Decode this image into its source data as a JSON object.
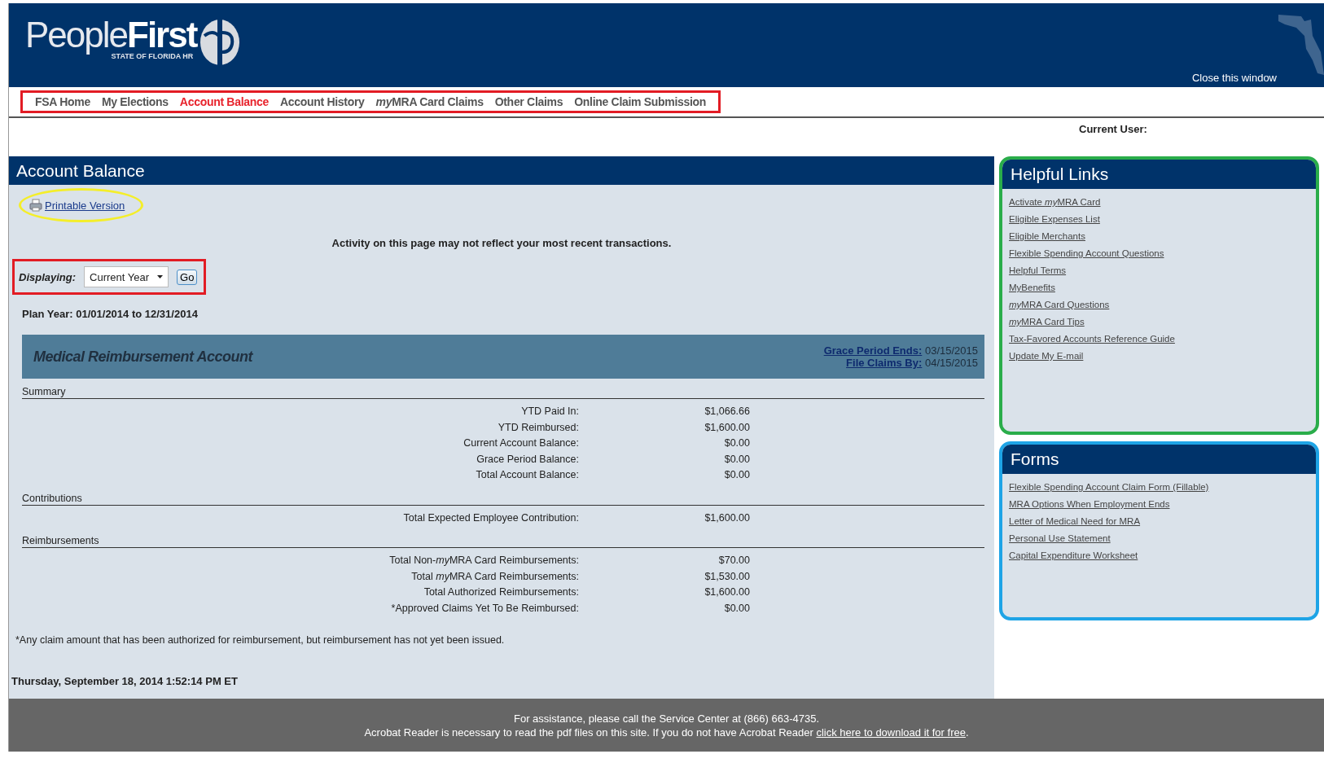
{
  "header": {
    "logo": {
      "word_1": "People",
      "word_2": "First",
      "tagline": "STATE OF FLORIDA HR"
    },
    "close_link": "Close this window"
  },
  "nav": [
    {
      "label": "FSA Home",
      "selected": false
    },
    {
      "label": "My Elections",
      "selected": false
    },
    {
      "label": "Account Balance",
      "selected": true
    },
    {
      "label": "Account History",
      "selected": false
    },
    {
      "label": [
        {
          "text": "my",
          "italic": true
        },
        {
          "text": "MRA Card Claims",
          "italic": false
        }
      ],
      "selected": false
    },
    {
      "label": "Other Claims",
      "selected": false
    },
    {
      "label": "Online Claim Submission",
      "selected": false
    }
  ],
  "current_user": {
    "label": "Current User:"
  },
  "main": {
    "title": "Account Balance",
    "printable_link": "Printable Version",
    "notice": "Activity on this page may not reflect your most recent transactions.",
    "displaying": {
      "label": "Displaying:",
      "value": "Current Year",
      "button": "Go"
    },
    "plan_year": "Plan Year: 01/01/2014 to 12/31/2014",
    "account": {
      "title": "Medical Reimbursement Account",
      "dates": [
        {
          "label": "Grace Period Ends:",
          "value": "03/15/2015"
        },
        {
          "label": "File Claims By:",
          "value": "04/15/2015"
        }
      ]
    },
    "sections": [
      {
        "title": "Summary",
        "rows": [
          {
            "label": "YTD Paid In:",
            "value": "$1,066.66"
          },
          {
            "label": "YTD Reimbursed:",
            "value": "$1,600.00"
          },
          {
            "label": "Current Account Balance:",
            "value": "$0.00"
          },
          {
            "label": "Grace Period Balance:",
            "value": "$0.00"
          },
          {
            "label": "Total Account Balance:",
            "value": "$0.00"
          }
        ]
      },
      {
        "title": "Contributions",
        "rows": [
          {
            "label": "Total Expected Employee Contribution:",
            "value": "$1,600.00"
          }
        ]
      },
      {
        "title": "Reimbursements",
        "rows": [
          {
            "label": [
              {
                "text": "Total Non-",
                "italic": false
              },
              {
                "text": "my",
                "italic": true
              },
              {
                "text": "MRA Card Reimbursements:",
                "italic": false
              }
            ],
            "value": "$70.00"
          },
          {
            "label": [
              {
                "text": "Total ",
                "italic": false
              },
              {
                "text": "my",
                "italic": true
              },
              {
                "text": "MRA Card Reimbursements:",
                "italic": false
              }
            ],
            "value": "$1,530.00"
          },
          {
            "label": "Total Authorized Reimbursements:",
            "value": "$1,600.00"
          },
          {
            "label": "*Approved Claims Yet To Be Reimbursed:",
            "value": "$0.00"
          }
        ]
      }
    ],
    "footnote": "*Any claim amount that has been authorized for reimbursement, but reimbursement has not yet been issued.",
    "timestamp": "Thursday, September 18, 2014 1:52:14 PM ET"
  },
  "sidebar": {
    "panels": [
      {
        "title": "Helpful Links",
        "links": [
          [
            {
              "text": "Activate ",
              "italic": false
            },
            {
              "text": "my",
              "italic": true
            },
            {
              "text": "MRA Card",
              "italic": false
            }
          ],
          "Eligible Expenses List",
          "Eligible Merchants",
          "Flexible Spending Account Questions",
          "Helpful Terms",
          "MyBenefits",
          [
            {
              "text": "my",
              "italic": true
            },
            {
              "text": "MRA Card Questions",
              "italic": false
            }
          ],
          [
            {
              "text": "my",
              "italic": true
            },
            {
              "text": "MRA Card Tips",
              "italic": false
            }
          ],
          "Tax-Favored Accounts Reference Guide",
          "Update My E-mail"
        ]
      },
      {
        "title": "Forms",
        "links": [
          "Flexible Spending Account Claim Form (Fillable)",
          "MRA Options When Employment Ends",
          "Letter of Medical Need for MRA",
          "Personal Use Statement",
          "Capital Expenditure Worksheet"
        ]
      }
    ]
  },
  "footer": {
    "line_1": "For assistance, please call the Service Center at (866) 663-4735.",
    "line_2": "Acrobat Reader is necessary to read the pdf files on this site. If you do not have Acrobat Reader",
    "link": "click here to download it for free",
    "line_2_end": "."
  }
}
